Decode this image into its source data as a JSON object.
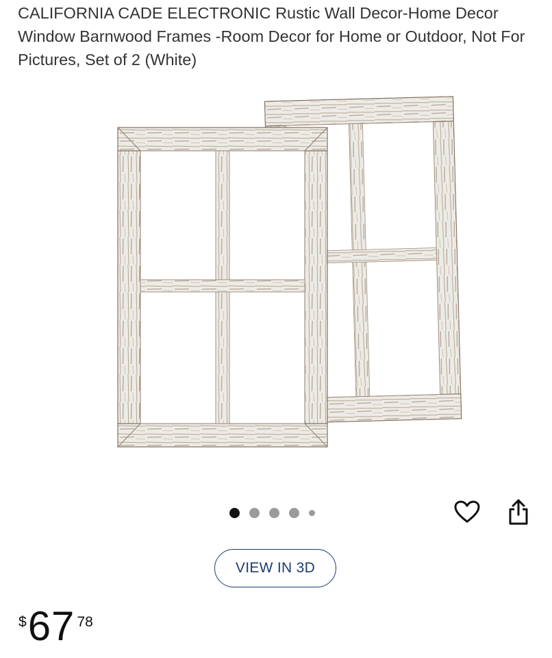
{
  "product": {
    "title": "CALIFORNIA CADE ELECTRONIC Rustic Wall Decor-Home Decor Window Barnwood Frames -Room Decor for Home or Outdoor, Not For Pictures, Set of 2 (White)"
  },
  "gallery": {
    "image_alt": "Two white-washed rustic barnwood window frames",
    "dots": 5,
    "active_index": 0
  },
  "actions": {
    "favorite_icon": "heart-icon",
    "share_icon": "share-icon",
    "view_3d_label": "VIEW IN 3D"
  },
  "price": {
    "symbol": "$",
    "whole": "67",
    "fraction": "78"
  },
  "colors": {
    "outline_blue": "#1c3b73",
    "dot_active": "#111111",
    "dot_inactive": "#9a9a9a"
  }
}
